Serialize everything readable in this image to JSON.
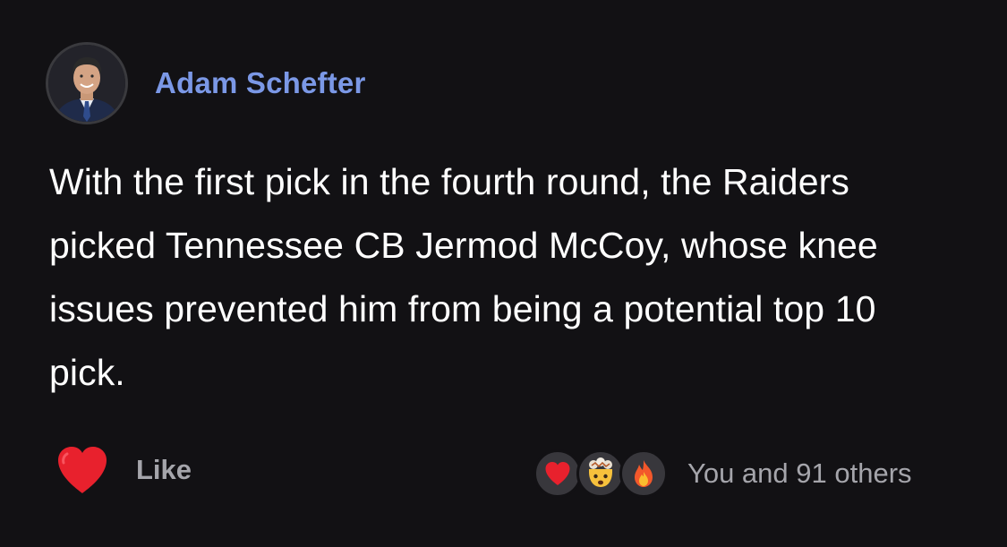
{
  "author": {
    "name": "Adam Schefter",
    "avatar_icon": "profile-photo"
  },
  "post": {
    "text": "With the first pick in the fourth round, the Raiders picked Tennessee CB Jermod McCoy, whose knee issues prevented him from being a potential top 10 pick."
  },
  "actions": {
    "like_label": "Like",
    "like_icon": "heart-icon",
    "like_color": "#e8212d"
  },
  "reactions": {
    "icons": [
      "heart-icon",
      "mind-blown-icon",
      "fire-icon"
    ],
    "summary": "You and 91 others"
  },
  "colors": {
    "background": "#121114",
    "author_link": "#7b98e6",
    "muted_text": "#a5a5ab"
  }
}
